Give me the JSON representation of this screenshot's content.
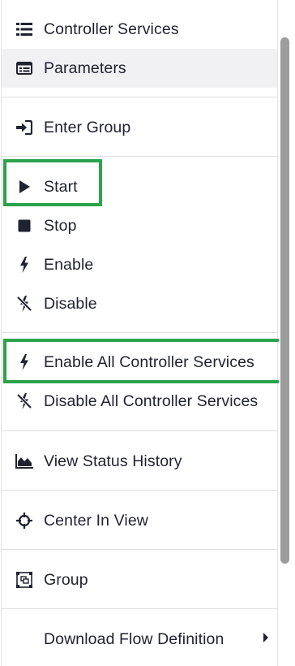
{
  "menu": {
    "items": {
      "controller_services": {
        "label": "Controller Services",
        "icon": "list-icon"
      },
      "parameters": {
        "label": "Parameters",
        "icon": "parameters-table-icon"
      },
      "enter_group": {
        "label": "Enter Group",
        "icon": "sign-in-icon"
      },
      "start": {
        "label": "Start",
        "icon": "play-icon"
      },
      "stop": {
        "label": "Stop",
        "icon": "stop-icon"
      },
      "enable": {
        "label": "Enable",
        "icon": "bolt-icon"
      },
      "disable": {
        "label": "Disable",
        "icon": "bolt-slash-icon"
      },
      "enable_all_cs": {
        "label": "Enable All Controller Services",
        "icon": "bolt-icon"
      },
      "disable_all_cs": {
        "label": "Disable All Controller Services",
        "icon": "bolt-slash-icon"
      },
      "view_status_history": {
        "label": "View Status History",
        "icon": "area-chart-icon"
      },
      "center_in_view": {
        "label": "Center In View",
        "icon": "crosshairs-icon"
      },
      "group": {
        "label": "Group",
        "icon": "group-icon"
      },
      "download_flow_definition": {
        "label": "Download Flow Definition",
        "icon": "caret-right-icon"
      }
    }
  },
  "colors": {
    "highlight": "#2ba24c",
    "hover": "#f1f1f4",
    "text": "#1f2230"
  }
}
